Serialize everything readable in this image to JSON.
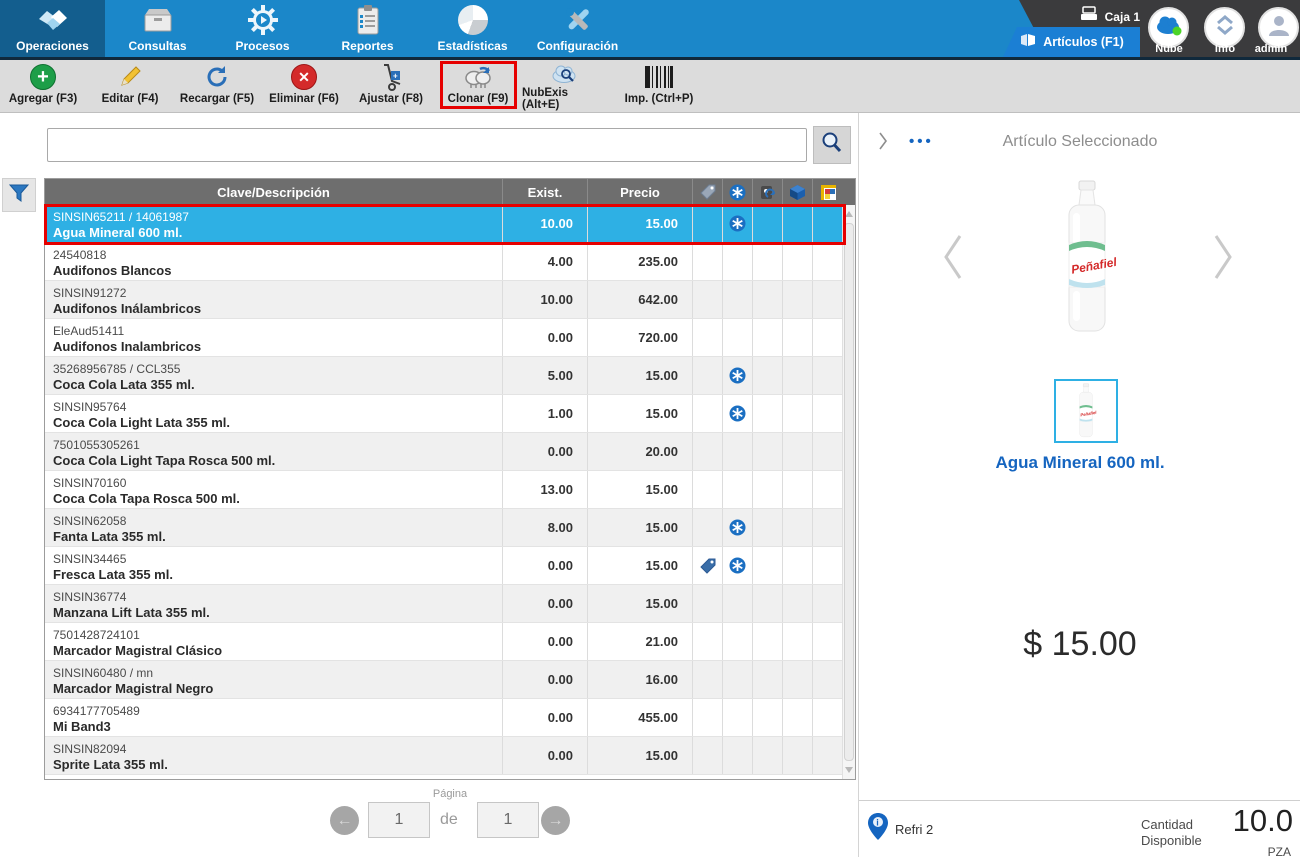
{
  "nav": {
    "tabs": [
      {
        "label": "Operaciones",
        "selected": true
      },
      {
        "label": "Consultas",
        "selected": false
      },
      {
        "label": "Procesos",
        "selected": false
      },
      {
        "label": "Reportes",
        "selected": false
      },
      {
        "label": "Estadísticas",
        "selected": false
      },
      {
        "label": "Configuración",
        "selected": false
      }
    ],
    "caja_label": "Caja 1",
    "articulos_tab_label": "Artículos (F1)",
    "circle_buttons": [
      {
        "label": "Nube"
      },
      {
        "label": "Info"
      },
      {
        "label": "admin"
      }
    ]
  },
  "toolbar": {
    "buttons": [
      {
        "label": "Agregar (F3)",
        "icon": "add-icon"
      },
      {
        "label": "Editar (F4)",
        "icon": "pencil-icon"
      },
      {
        "label": "Recargar (F5)",
        "icon": "refresh-icon"
      },
      {
        "label": "Eliminar (F6)",
        "icon": "delete-icon"
      },
      {
        "label": "Ajustar (F8)",
        "icon": "handtruck-icon"
      },
      {
        "label": "Clonar (F9)",
        "icon": "clone-sheep-icon",
        "highlighted": true
      },
      {
        "label": "NubExis (Alt+E)",
        "icon": "cloud-search-icon"
      },
      {
        "label": "Imp. (Ctrl+P)",
        "icon": "barcode-icon"
      }
    ]
  },
  "search": {
    "value": "",
    "placeholder": ""
  },
  "table": {
    "headers": {
      "clave": "Clave/Descripción",
      "exist": "Exist.",
      "precio": "Precio"
    },
    "header_icons": [
      "tag-icon",
      "kit-icon",
      "sync-article-icon",
      "cube-icon",
      "image-icon"
    ],
    "rows": [
      {
        "clave": "SINSIN65211 / 14061987",
        "desc": "Agua Mineral 600 ml.",
        "exist": "10.00",
        "precio": "15.00",
        "icons": [
          "asterisk"
        ],
        "selected": true
      },
      {
        "clave": "24540818",
        "desc": "Audifonos Blancos",
        "exist": "4.00",
        "precio": "235.00",
        "icons": []
      },
      {
        "clave": "SINSIN91272",
        "desc": "Audifonos Inálambricos",
        "exist": "10.00",
        "precio": "642.00",
        "icons": []
      },
      {
        "clave": "EleAud51411",
        "desc": "Audifonos Inalambricos",
        "exist": "0.00",
        "precio": "720.00",
        "icons": []
      },
      {
        "clave": "35268956785 / CCL355",
        "desc": "Coca Cola Lata 355 ml.",
        "exist": "5.00",
        "precio": "15.00",
        "icons": [
          "asterisk"
        ]
      },
      {
        "clave": "SINSIN95764",
        "desc": "Coca Cola Light Lata 355 ml.",
        "exist": "1.00",
        "precio": "15.00",
        "icons": [
          "asterisk"
        ]
      },
      {
        "clave": "7501055305261",
        "desc": "Coca Cola Light Tapa Rosca 500 ml.",
        "exist": "0.00",
        "precio": "20.00",
        "icons": []
      },
      {
        "clave": "SINSIN70160",
        "desc": "Coca Cola Tapa Rosca 500 ml.",
        "exist": "13.00",
        "precio": "15.00",
        "icons": []
      },
      {
        "clave": "SINSIN62058",
        "desc": "Fanta Lata 355 ml.",
        "exist": "8.00",
        "precio": "15.00",
        "icons": [
          "asterisk"
        ]
      },
      {
        "clave": "SINSIN34465",
        "desc": "Fresca Lata 355 ml.",
        "exist": "0.00",
        "precio": "15.00",
        "icons": [
          "tag",
          "asterisk"
        ]
      },
      {
        "clave": "SINSIN36774",
        "desc": "Manzana Lift Lata 355 ml.",
        "exist": "0.00",
        "precio": "15.00",
        "icons": []
      },
      {
        "clave": "7501428724101",
        "desc": "Marcador Magistral Clásico",
        "exist": "0.00",
        "precio": "21.00",
        "icons": []
      },
      {
        "clave": "SINSIN60480 / mn",
        "desc": "Marcador Magistral Negro",
        "exist": "0.00",
        "precio": "16.00",
        "icons": []
      },
      {
        "clave": "6934177705489",
        "desc": "Mi Band3",
        "exist": "0.00",
        "precio": "455.00",
        "icons": []
      },
      {
        "clave": "SINSIN82094",
        "desc": "Sprite Lata 355 ml.",
        "exist": "0.00",
        "precio": "15.00",
        "icons": []
      }
    ]
  },
  "pagination": {
    "label": "Página",
    "current": "1",
    "separator": "de",
    "total": "1",
    "prev": "←",
    "next": "→"
  },
  "detail": {
    "dots": "•••",
    "title": "Artículo Seleccionado",
    "bottle_brand": "Peñafiel",
    "product_name": "Agua Mineral 600 ml.",
    "price": "$ 15.00",
    "location": "Refri 2",
    "qty_label_line1": "Cantidad",
    "qty_label_line2": "Disponible",
    "qty_value": "10.0",
    "qty_unit": "PZA"
  },
  "colors": {
    "nav_blue": "#1b87c9",
    "nav_selected": "#135e8e",
    "articulos_tab_blue": "#1b7fd4",
    "dark_header": "#3b3b3d",
    "selection_blue": "#2eb0e4",
    "highlight_red": "#e60000",
    "accent_blue": "#1565c0",
    "table_header_gray": "#6e6e6e",
    "success_green": "#1d9e48",
    "danger_red": "#d42a2a"
  }
}
